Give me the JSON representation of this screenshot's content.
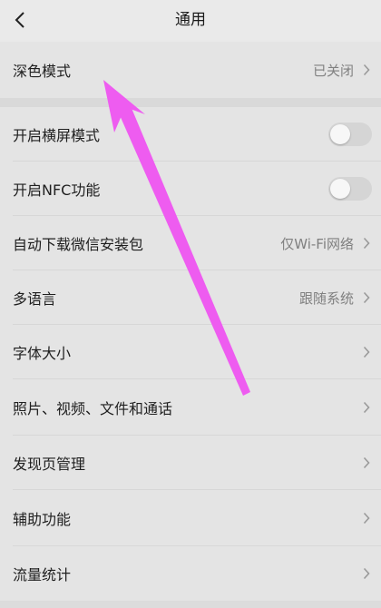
{
  "header": {
    "title": "通用"
  },
  "settings": {
    "dark_mode": {
      "label": "深色模式",
      "value": "已关闭"
    },
    "items": [
      {
        "label": "开启横屏模式",
        "control": "toggle",
        "on": false
      },
      {
        "label": "开启NFC功能",
        "control": "toggle",
        "on": false
      },
      {
        "label": "自动下载微信安装包",
        "value": "仅Wi-Fi网络",
        "control": "chevron"
      },
      {
        "label": "多语言",
        "value": "跟随系统",
        "control": "chevron"
      },
      {
        "label": "字体大小",
        "control": "chevron"
      },
      {
        "label": "照片、视频、文件和通话",
        "control": "chevron"
      },
      {
        "label": "发现页管理",
        "control": "chevron"
      },
      {
        "label": "辅助功能",
        "control": "chevron"
      },
      {
        "label": "流量统计",
        "control": "chevron"
      }
    ]
  },
  "colors": {
    "background": "#e9e9e9",
    "row_background": "#e4e4e4",
    "toggle_off": "#d5d5d5",
    "annotation_arrow": "#ee5cf0"
  },
  "icons": {
    "back": "chevron-left-icon",
    "disclosure": "chevron-right-icon"
  }
}
